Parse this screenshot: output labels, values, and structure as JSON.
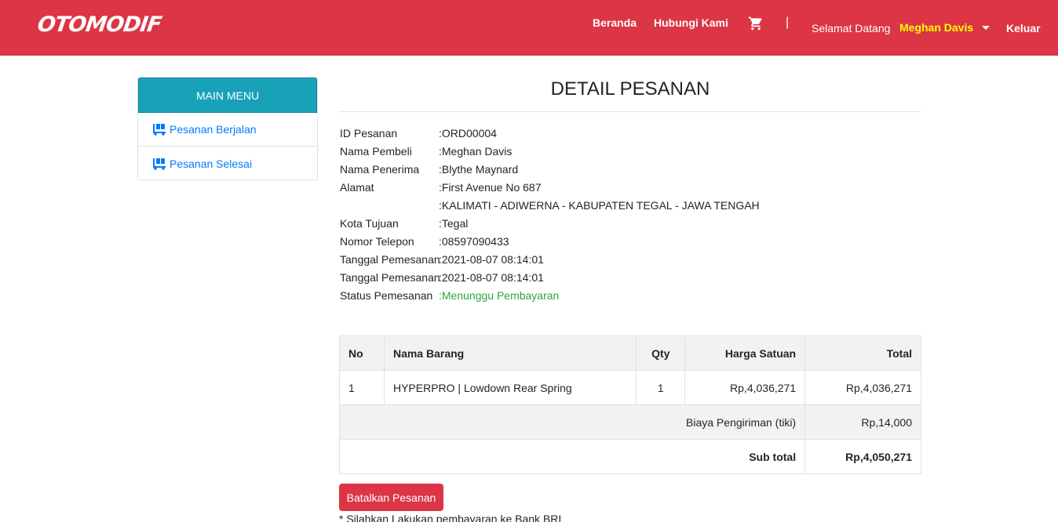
{
  "navbar": {
    "brand": "OTOMODIF",
    "links": {
      "beranda": "Beranda",
      "hubungi": "Hubungi Kami"
    },
    "cart_icon": "shopping-cart-icon",
    "separator": "|",
    "greeting": "Selamat Datang",
    "user_name": "Meghan Davis",
    "logout": "Keluar",
    "colors": {
      "background": "#dc3545",
      "user_name": "#ffff00"
    }
  },
  "sidebar": {
    "header": "MAIN MENU",
    "items": [
      {
        "label": "Pesanan Berjalan",
        "icon": "dolly-cart-icon"
      },
      {
        "label": "Pesanan Selesai",
        "icon": "dolly-cart-icon"
      }
    ],
    "colors": {
      "header": "#17a2b8",
      "link": "#007bff"
    }
  },
  "main": {
    "title": "DETAIL PESANAN",
    "details": [
      {
        "label": "ID Pesanan",
        "value": ":ORD00004"
      },
      {
        "label": "Nama Pembeli",
        "value": ":Meghan Davis"
      },
      {
        "label": "Nama Penerima",
        "value": ":Blythe Maynard"
      },
      {
        "label": "Alamat",
        "value": ":First Avenue No 687"
      },
      {
        "label": "",
        "value": ":KALIMATI - ADIWERNA - KABUPATEN TEGAL - JAWA TENGAH"
      },
      {
        "label": "Kota Tujuan",
        "value": ":Tegal"
      },
      {
        "label": "Nomor Telepon",
        "value": ":08597090433"
      },
      {
        "label": "Tanggal Pemesanan",
        "value": ":2021-08-07 08:14:01"
      },
      {
        "label": "Tanggal Pemesanan",
        "value": ":2021-08-07 08:14:01"
      },
      {
        "label": "Status Pemesanan",
        "value": ":Menunggu Pembayaran"
      }
    ],
    "status_color": "#28a745",
    "table": {
      "headers": {
        "no": "No",
        "name": "Nama Barang",
        "qty": "Qty",
        "price": "Harga Satuan",
        "total": "Total"
      },
      "rows": [
        {
          "no": "1",
          "name": "HYPERPRO | Lowdown Rear Spring",
          "qty": "1",
          "price": "Rp,4,036,271",
          "total": "Rp,4,036,271"
        }
      ],
      "shipping_label": "Biaya Pengiriman (tiki)",
      "shipping_value": "Rp,14,000",
      "subtotal_label": "Sub total",
      "subtotal_value": "Rp,4,050,271"
    },
    "cancel_button": "Batalkan Pesanan",
    "note": "* Silahkan Lakukan pembayaran ke Bank BRI"
  }
}
